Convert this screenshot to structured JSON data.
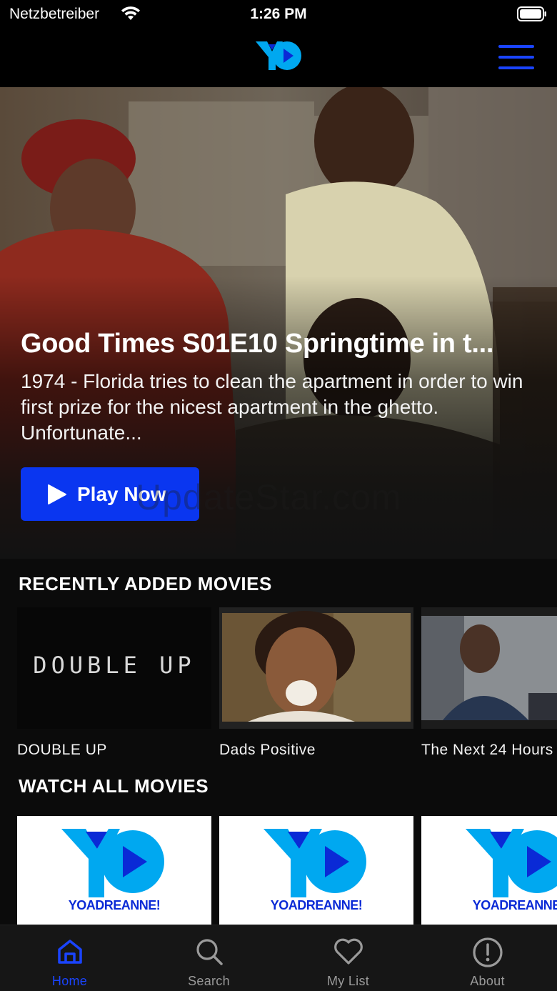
{
  "status_bar": {
    "carrier": "Netzbetreiber",
    "time": "1:26 PM"
  },
  "header": {
    "logo_text": "YOADREANNE!",
    "menu_icon": "hamburger-menu-icon",
    "accent_color": "#1a44ff"
  },
  "hero": {
    "title": "Good Times S01E10 Springtime in t...",
    "description": "1974 - Florida tries to clean the apartment in order to win first prize for the nicest apartment in the ghetto. Unfortunate...",
    "play_label": "Play Now",
    "watermark": "UpdateStar.com"
  },
  "recently_added": {
    "title": "RECENTLY ADDED MOVIES",
    "items": [
      {
        "title": "DOUBLE UP",
        "thumb_text": "DOUBLE UP"
      },
      {
        "title": "Dads Positive"
      },
      {
        "title": "The Next 24 Hours"
      }
    ]
  },
  "all_movies": {
    "title": "WATCH ALL MOVIES",
    "items": [
      {
        "brand_yo": "YO",
        "brand_name": "ADREANNE!"
      },
      {
        "brand_yo": "YO",
        "brand_name": "ADREANNE!"
      },
      {
        "brand_yo": "YO",
        "brand_name": "ADREANNE!"
      }
    ]
  },
  "tab_bar": {
    "tabs": [
      {
        "label": "Home",
        "icon": "home-icon",
        "active": true
      },
      {
        "label": "Search",
        "icon": "search-icon",
        "active": false
      },
      {
        "label": "My List",
        "icon": "heart-icon",
        "active": false
      },
      {
        "label": "About",
        "icon": "info-icon",
        "active": false
      }
    ]
  }
}
